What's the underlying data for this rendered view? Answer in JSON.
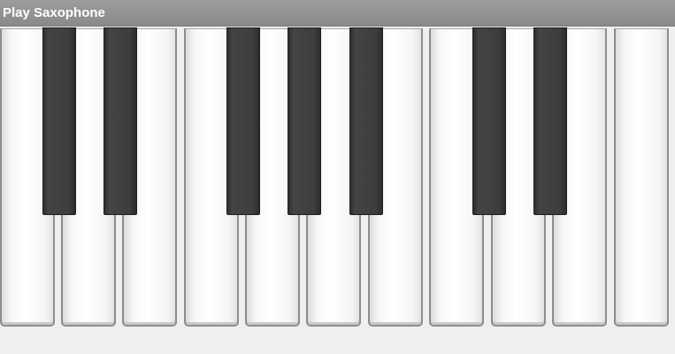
{
  "app": {
    "title": "Play Saxophone"
  },
  "keyboard": {
    "white_key_count": 11,
    "black_key_count": 7,
    "colors": {
      "title_bar": "#949494",
      "white_key": "#ffffff",
      "black_key": "#3d3d3d",
      "key_border": "#8d8d8d",
      "background": "#efefef"
    }
  }
}
